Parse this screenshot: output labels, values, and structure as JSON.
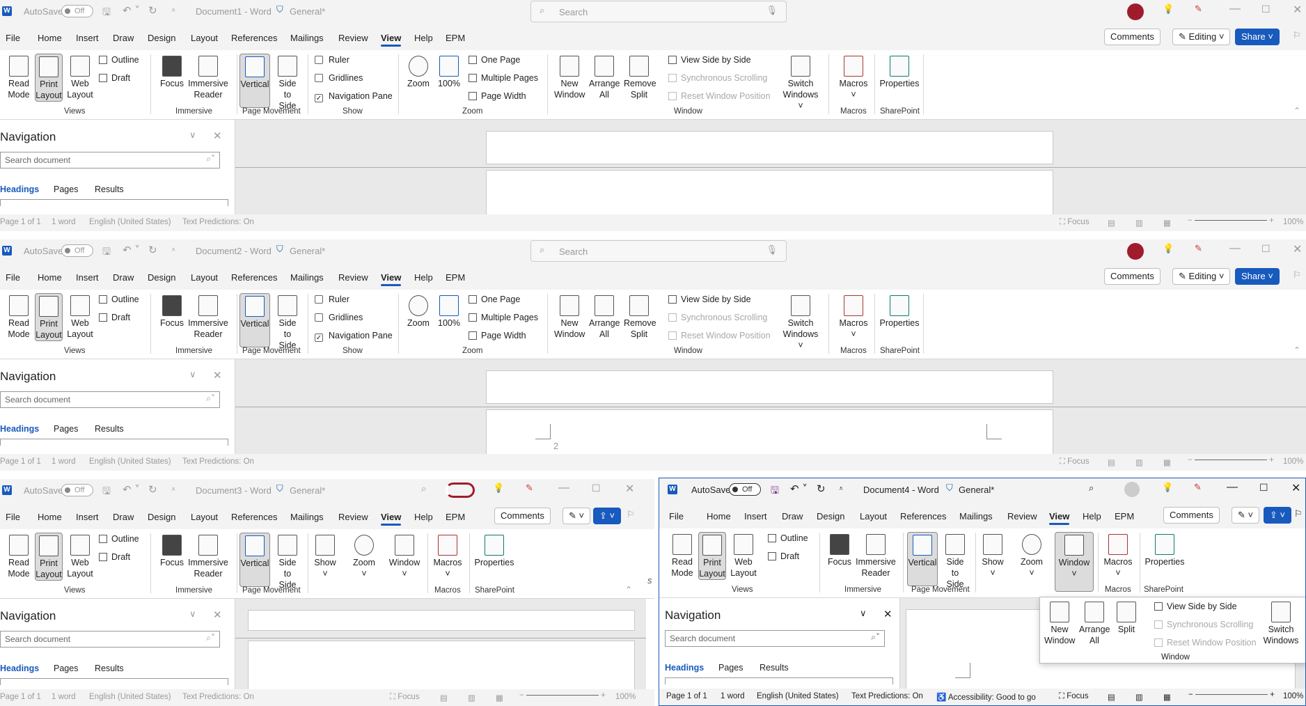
{
  "app": {
    "autosave_label": "AutoSave",
    "autosave_state": "Off",
    "sensitivity": "General*",
    "search_placeholder": "Search",
    "accent": "#185abd"
  },
  "tabs": [
    "File",
    "Home",
    "Insert",
    "Draw",
    "Design",
    "Layout",
    "References",
    "Mailings",
    "Review",
    "View",
    "Help",
    "EPM"
  ],
  "selected_tab": "View",
  "buttons": {
    "comments": "Comments",
    "editing": "Editing",
    "share": "Share"
  },
  "windows": [
    {
      "title": "Document1 - Word"
    },
    {
      "title": "Document2 - Word"
    },
    {
      "title": "Document3 - Word"
    },
    {
      "title": "Document4 - Word"
    }
  ],
  "ribbon": {
    "read_mode": [
      "Read",
      "Mode"
    ],
    "print_layout": [
      "Print",
      "Layout"
    ],
    "web_layout": [
      "Web",
      "Layout"
    ],
    "outline": "Outline",
    "draft": "Draft",
    "views": "Views",
    "focus": "Focus",
    "immersive_reader": [
      "Immersive",
      "Reader"
    ],
    "immersive": "Immersive",
    "vertical": "Vertical",
    "side_to_side": [
      "Side",
      "to Side"
    ],
    "page_movement": "Page Movement",
    "ruler": "Ruler",
    "gridlines": "Gridlines",
    "navigation_pane": "Navigation Pane",
    "show": "Show",
    "zoom": "Zoom",
    "pct100": "100%",
    "one_page": "One Page",
    "multiple_pages": "Multiple Pages",
    "page_width": "Page Width",
    "new_window": [
      "New",
      "Window"
    ],
    "arrange_all": [
      "Arrange",
      "All"
    ],
    "remove_split": [
      "Remove",
      "Split"
    ],
    "split": "Split",
    "view_side_by_side": "View Side by Side",
    "synchronous_scrolling": "Synchronous Scrolling",
    "reset_window_position": "Reset Window Position",
    "window": "Window",
    "switch_windows": [
      "Switch",
      "Windows"
    ],
    "macros": "Macros",
    "properties": "Properties",
    "sharepoint": "SharePoint"
  },
  "navigation": {
    "title": "Navigation",
    "search_placeholder": "Search document",
    "tabs": [
      "Headings",
      "Pages",
      "Results"
    ]
  },
  "status": {
    "page": "Page 1 of 1",
    "words": "1 word",
    "language": "English (United States)",
    "predictions": "Text Predictions: On",
    "accessibility": "Accessibility: Good to go",
    "focus": "Focus",
    "zoom": "100%"
  },
  "page_number_marker": "2",
  "clipped_text": "s"
}
